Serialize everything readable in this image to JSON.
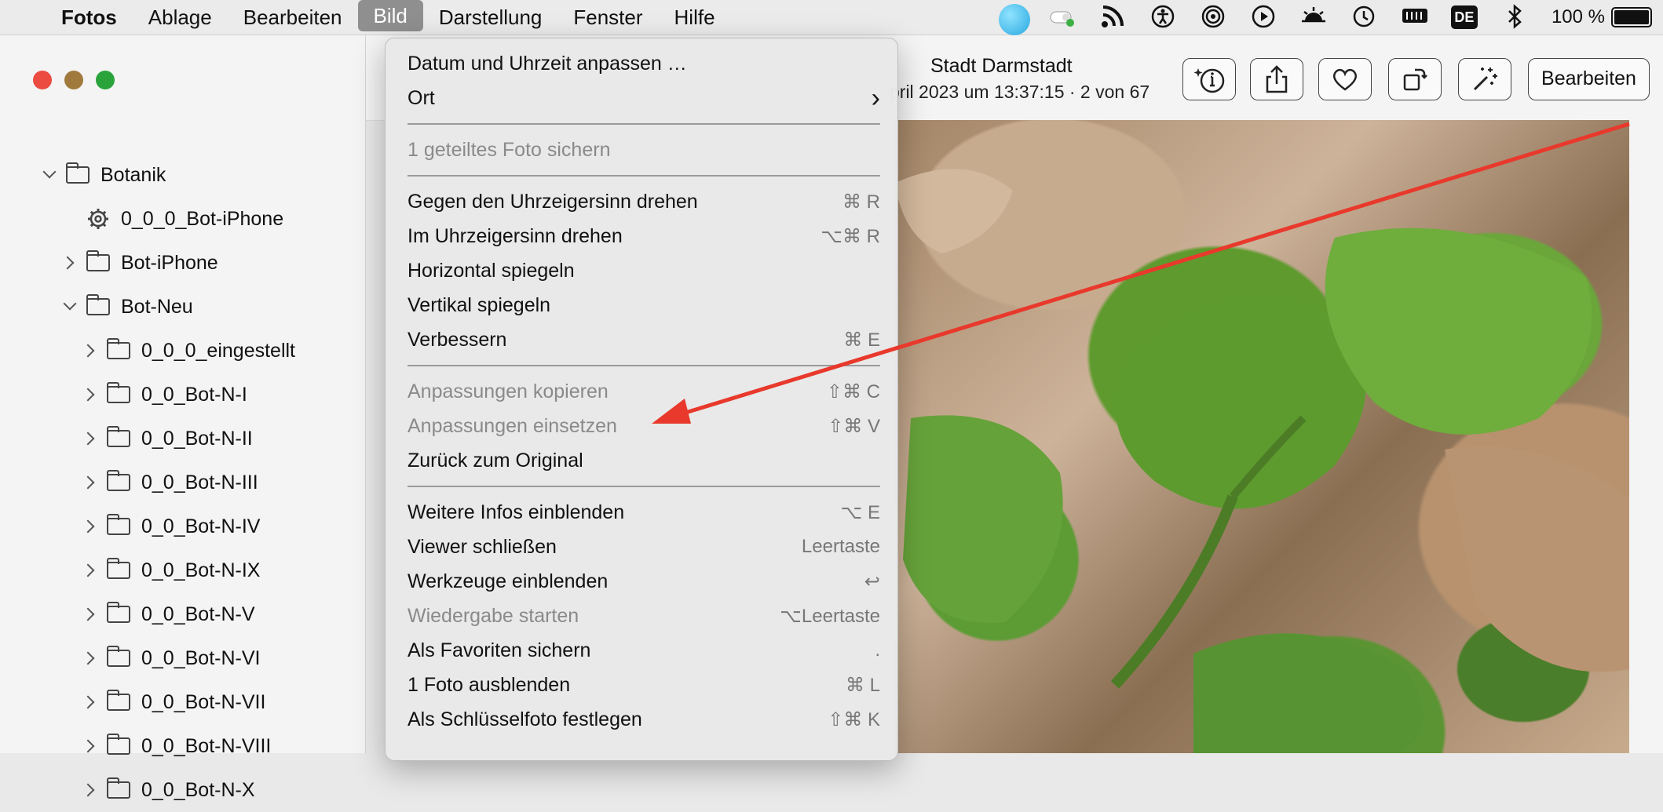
{
  "menubar": {
    "apple": "",
    "app": "Fotos",
    "items": [
      "Ablage",
      "Bearbeiten",
      "Bild",
      "Darstellung",
      "Fenster",
      "Hilfe"
    ],
    "active": "Bild",
    "status": {
      "keyboard": "DE",
      "battery": "100 %"
    }
  },
  "sidebar": {
    "tree": [
      {
        "label": "Botanik",
        "indent": 0,
        "chevron": "down",
        "icon": "folder"
      },
      {
        "label": "0_0_0_Bot-iPhone",
        "indent": 1,
        "chevron": "none",
        "icon": "gear"
      },
      {
        "label": "Bot-iPhone",
        "indent": 1,
        "chevron": "right",
        "icon": "folder"
      },
      {
        "label": "Bot-Neu",
        "indent": 1,
        "chevron": "down",
        "icon": "folder"
      },
      {
        "label": "0_0_0_eingestellt",
        "indent": 2,
        "chevron": "right",
        "icon": "folder"
      },
      {
        "label": "0_0_Bot-N-I",
        "indent": 2,
        "chevron": "right",
        "icon": "folder"
      },
      {
        "label": "0_0_Bot-N-II",
        "indent": 2,
        "chevron": "right",
        "icon": "folder"
      },
      {
        "label": "0_0_Bot-N-III",
        "indent": 2,
        "chevron": "right",
        "icon": "folder"
      },
      {
        "label": "0_0_Bot-N-IV",
        "indent": 2,
        "chevron": "right",
        "icon": "folder"
      },
      {
        "label": "0_0_Bot-N-IX",
        "indent": 2,
        "chevron": "right",
        "icon": "folder"
      },
      {
        "label": "0_0_Bot-N-V",
        "indent": 2,
        "chevron": "right",
        "icon": "folder"
      },
      {
        "label": "0_0_Bot-N-VI",
        "indent": 2,
        "chevron": "right",
        "icon": "folder"
      },
      {
        "label": "0_0_Bot-N-VII",
        "indent": 2,
        "chevron": "right",
        "icon": "folder"
      },
      {
        "label": "0_0_Bot-N-VIII",
        "indent": 2,
        "chevron": "right",
        "icon": "folder"
      },
      {
        "label": "0_0_Bot-N-X",
        "indent": 2,
        "chevron": "right",
        "icon": "folder"
      }
    ]
  },
  "toolbar": {
    "title": "Stadt Darmstadt",
    "subtitle": "pril 2023 um 13:37:15  ·  2 von 67",
    "edit_label": "Bearbeiten"
  },
  "menu": {
    "groups": [
      [
        {
          "label": "Datum und Uhrzeit anpassen …",
          "shortcut": "",
          "disabled": false
        },
        {
          "label": "Ort",
          "shortcut": "›",
          "disabled": false
        }
      ],
      [
        {
          "label": "1 geteiltes Foto sichern",
          "shortcut": "",
          "disabled": true
        }
      ],
      [
        {
          "label": "Gegen den Uhrzeigersinn drehen",
          "shortcut": "⌘ R",
          "disabled": false
        },
        {
          "label": "Im Uhrzeigersinn drehen",
          "shortcut": "⌥⌘ R",
          "disabled": false
        },
        {
          "label": "Horizontal spiegeln",
          "shortcut": "",
          "disabled": false
        },
        {
          "label": "Vertikal spiegeln",
          "shortcut": "",
          "disabled": false
        },
        {
          "label": "Verbessern",
          "shortcut": "⌘ E",
          "disabled": false
        }
      ],
      [
        {
          "label": "Anpassungen kopieren",
          "shortcut": "⇧⌘ C",
          "disabled": true
        },
        {
          "label": "Anpassungen einsetzen",
          "shortcut": "⇧⌘ V",
          "disabled": true
        },
        {
          "label": "Zurück zum Original",
          "shortcut": "",
          "disabled": false
        }
      ],
      [
        {
          "label": "Weitere Infos einblenden",
          "shortcut": "⌥ E",
          "disabled": false
        },
        {
          "label": "Viewer schließen",
          "shortcut": "Leertaste",
          "disabled": false
        },
        {
          "label": "Werkzeuge einblenden",
          "shortcut": "↩",
          "disabled": false
        },
        {
          "label": "Wiedergabe starten",
          "shortcut": "⌥Leertaste",
          "disabled": true
        },
        {
          "label": "Als Favoriten sichern",
          "shortcut": ".",
          "disabled": false
        },
        {
          "label": "1 Foto ausblenden",
          "shortcut": "⌘ L",
          "disabled": false
        },
        {
          "label": "Als Schlüsselfoto festlegen",
          "shortcut": "⇧⌘ K",
          "disabled": false
        }
      ]
    ]
  },
  "colors": {
    "close": "#ec4b41",
    "minimize": "#a07a3c",
    "zoom": "#2aa33a",
    "annotation_arrow": "#e8392c"
  }
}
